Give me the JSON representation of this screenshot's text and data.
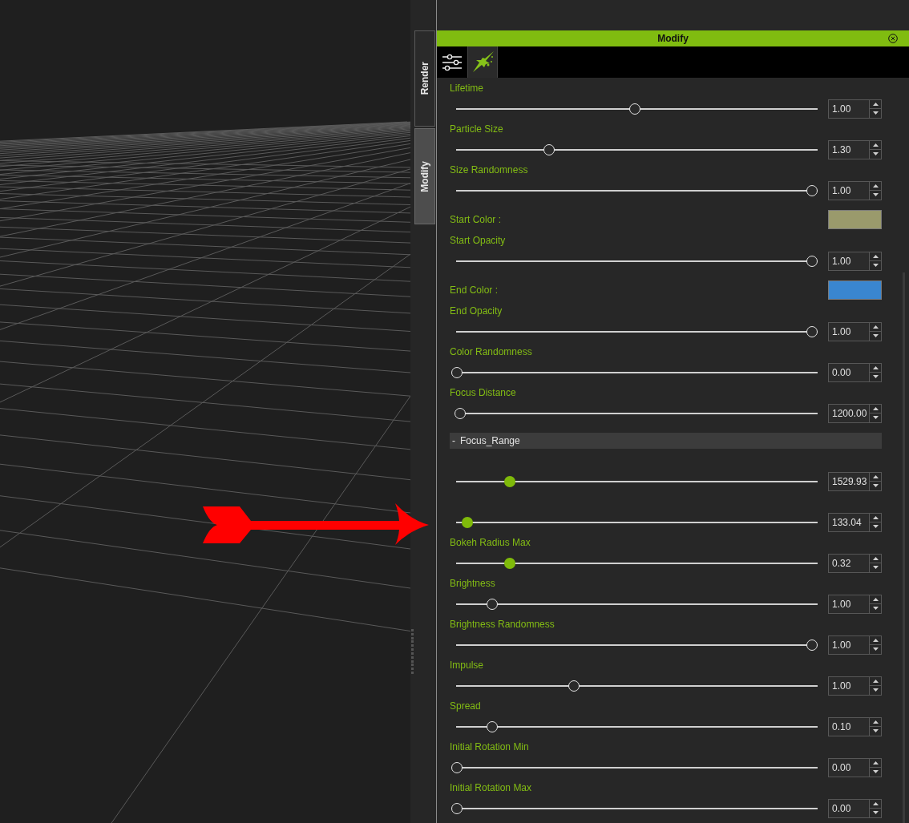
{
  "side_tabs": [
    {
      "label": "Render",
      "selected": false
    },
    {
      "label": "Modify",
      "selected": true
    }
  ],
  "panel": {
    "title": "Modify",
    "tabs": [
      {
        "kind": "sliders",
        "selected": false
      },
      {
        "kind": "particle",
        "selected": true
      }
    ],
    "rows": [
      {
        "kind": "slider",
        "label": "Lifetime",
        "level": 0.5,
        "value": "1.00",
        "highlighted": false
      },
      {
        "kind": "slider",
        "label": "Particle Size",
        "level": 0.26,
        "value": "1.30",
        "highlighted": false
      },
      {
        "kind": "slider",
        "label": "Size Randomness",
        "level": 1,
        "value": "1.00",
        "highlighted": false
      },
      {
        "kind": "color",
        "label": "Start Color :",
        "color": "#9a9a6c"
      },
      {
        "kind": "slider",
        "label": "Start Opacity",
        "level": 1,
        "value": "1.00",
        "highlighted": false
      },
      {
        "kind": "color",
        "label": "End Color :",
        "color": "#3a86cf"
      },
      {
        "kind": "slider",
        "label": "End Opacity",
        "level": 1,
        "value": "1.00",
        "highlighted": false
      },
      {
        "kind": "slider",
        "label": "Color Randomness",
        "level": 0,
        "value": "0.00",
        "highlighted": false
      },
      {
        "kind": "slider",
        "label": "Focus Distance",
        "level": 0.01,
        "value": "1200.00",
        "highlighted": false
      },
      {
        "kind": "group",
        "toggle": "-",
        "label": "Focus_Range"
      },
      {
        "kind": "slider",
        "level": 0.15,
        "value": "1529.93",
        "highlighted": true
      },
      {
        "kind": "slider",
        "level": 0.03,
        "value": "133.04",
        "highlighted": true
      },
      {
        "kind": "slider",
        "label": "Bokeh Radius Max",
        "level": 0.15,
        "value": "0.32",
        "highlighted": true
      },
      {
        "kind": "slider",
        "label": "Brightness",
        "level": 0.1,
        "value": "1.00",
        "highlighted": false
      },
      {
        "kind": "slider",
        "label": "Brightness Randomness",
        "level": 1,
        "value": "1.00",
        "highlighted": false
      },
      {
        "kind": "slider",
        "label": "Impulse",
        "level": 0.33,
        "value": "1.00",
        "highlighted": false
      },
      {
        "kind": "slider",
        "label": "Spread",
        "level": 0.1,
        "value": "0.10",
        "highlighted": false
      },
      {
        "kind": "slider",
        "label": "Initial Rotation Min",
        "level": 0,
        "value": "0.00",
        "highlighted": false
      },
      {
        "kind": "slider",
        "label": "Initial Rotation Max",
        "level": 0,
        "value": "0.00",
        "highlighted": false
      }
    ]
  }
}
